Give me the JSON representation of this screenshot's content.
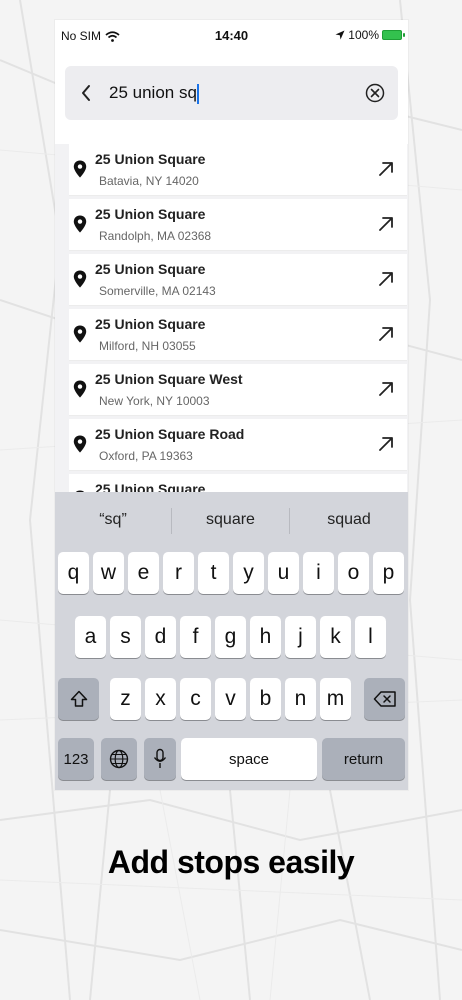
{
  "status_bar": {
    "carrier": "No SIM",
    "time": "14:40",
    "battery": "100%"
  },
  "search": {
    "query": "25 union sq"
  },
  "results": [
    {
      "title": "25 Union Square",
      "subtitle": "Batavia, NY 14020"
    },
    {
      "title": "25 Union Square",
      "subtitle": "Randolph, MA 02368"
    },
    {
      "title": "25 Union Square",
      "subtitle": "Somerville, MA 02143"
    },
    {
      "title": "25 Union Square",
      "subtitle": "Milford, NH 03055"
    },
    {
      "title": "25 Union Square West",
      "subtitle": "New York, NY 10003"
    },
    {
      "title": "25 Union Square Road",
      "subtitle": "Oxford, PA 19363"
    },
    {
      "title": "25 Union Square",
      "subtitle": ""
    }
  ],
  "keyboard": {
    "suggestions": [
      "“sq”",
      "square",
      "squad"
    ],
    "row1": [
      "q",
      "w",
      "e",
      "r",
      "t",
      "y",
      "u",
      "i",
      "o",
      "p"
    ],
    "row2": [
      "a",
      "s",
      "d",
      "f",
      "g",
      "h",
      "j",
      "k",
      "l"
    ],
    "row3": [
      "z",
      "x",
      "c",
      "v",
      "b",
      "n",
      "m"
    ],
    "numbers_key": "123",
    "space_key": "space",
    "return_key": "return"
  },
  "tagline": "Add stops easily",
  "icons": {
    "back": "chevron-left-icon",
    "clear": "clear-circle-icon",
    "pin": "map-pin-icon",
    "arrow": "arrow-up-right-icon",
    "shift": "shift-icon",
    "delete": "backspace-icon",
    "globe": "globe-icon",
    "mic": "microphone-icon"
  },
  "colors": {
    "battery": "#33c14e",
    "caret": "#1a73e8"
  }
}
